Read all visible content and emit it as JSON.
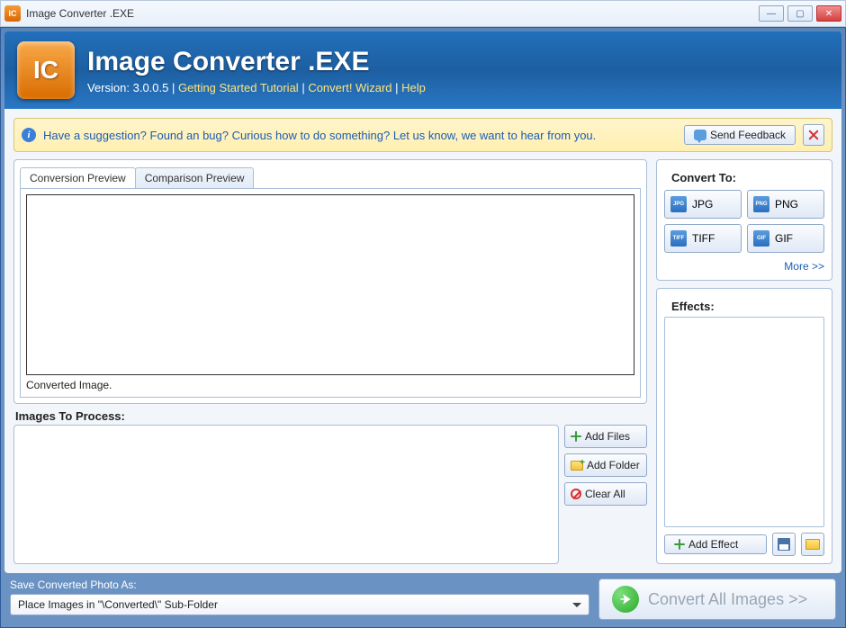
{
  "window": {
    "title": "Image Converter .EXE"
  },
  "banner": {
    "title": "Image Converter .EXE",
    "version_label": "Version:",
    "version": "3.0.0.5",
    "link_tutorial": "Getting Started Tutorial",
    "link_wizard": "Convert! Wizard",
    "link_help": "Help"
  },
  "infobar": {
    "text": "Have a suggestion? Found an bug? Curious how to do something? Let us know, we want to hear from you.",
    "send_feedback": "Send Feedback"
  },
  "tabs": {
    "conversion": "Conversion Preview",
    "comparison": "Comparison Preview",
    "converted_label": "Converted Image."
  },
  "process": {
    "label": "Images To Process:",
    "add_files": "Add Files",
    "add_folder": "Add Folder",
    "clear_all": "Clear All"
  },
  "convert_to": {
    "title": "Convert To:",
    "jpg": "JPG",
    "png": "PNG",
    "tiff": "TIFF",
    "gif": "GIF",
    "more": "More >>"
  },
  "effects": {
    "title": "Effects:",
    "add_effect": "Add Effect"
  },
  "footer": {
    "save_label": "Save Converted Photo As:",
    "save_value": "Place Images in \"\\Converted\\\" Sub-Folder",
    "convert_all": "Convert All Images >>"
  },
  "icon_badges": {
    "jpg": "JPG",
    "png": "PNG",
    "tiff": "TIFF",
    "gif": "GIF"
  }
}
